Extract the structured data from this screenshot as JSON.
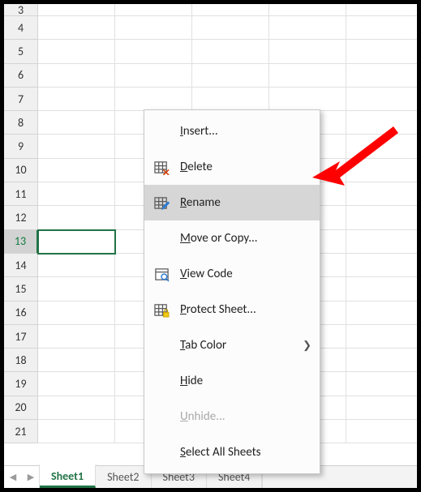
{
  "row_start": 3,
  "row_end": 21,
  "selected_row": 13,
  "tabs": {
    "nav_prev_glyph": "◀",
    "nav_next_glyph": "▶",
    "list": [
      {
        "name": "Sheet1",
        "active": true
      },
      {
        "name": "Sheet2",
        "active": false
      },
      {
        "name": "Sheet3",
        "active": false
      },
      {
        "name": "Sheet4",
        "active": false
      }
    ]
  },
  "menu": {
    "items": [
      {
        "id": "insert",
        "label": "Insert...",
        "hotkey": "I",
        "icon": "",
        "disabled": false
      },
      {
        "id": "delete",
        "label": "Delete",
        "hotkey": "D",
        "icon": "delete",
        "disabled": false
      },
      {
        "id": "rename",
        "label": "Rename",
        "hotkey": "R",
        "icon": "rename",
        "disabled": false,
        "highlight": true
      },
      {
        "id": "move",
        "label": "Move or Copy...",
        "hotkey": "M",
        "icon": "",
        "disabled": false
      },
      {
        "id": "code",
        "label": "View Code",
        "hotkey": "V",
        "icon": "code",
        "disabled": false
      },
      {
        "id": "protect",
        "label": "Protect Sheet...",
        "hotkey": "P",
        "icon": "protect",
        "disabled": false
      },
      {
        "id": "tabcolor",
        "label": "Tab Color",
        "hotkey": "T",
        "icon": "",
        "disabled": false,
        "submenu": true
      },
      {
        "id": "hide",
        "label": "Hide",
        "hotkey": "H",
        "icon": "",
        "disabled": false
      },
      {
        "id": "unhide",
        "label": "Unhide...",
        "hotkey": "U",
        "icon": "",
        "disabled": true
      },
      {
        "id": "selall",
        "label": "Select All Sheets",
        "hotkey": "S",
        "icon": "",
        "disabled": false
      }
    ]
  },
  "arrow_color": "#ff0000"
}
